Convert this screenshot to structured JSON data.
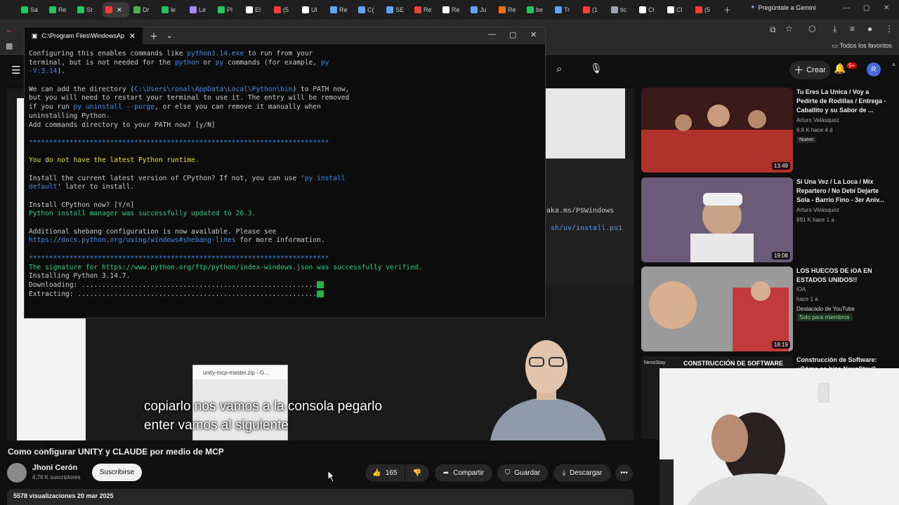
{
  "browser": {
    "tabs": [
      {
        "label": "Sa",
        "color": "#22c55e"
      },
      {
        "label": "Re",
        "color": "#22c55e"
      },
      {
        "label": "St",
        "color": "#22c55e"
      },
      {
        "label": "",
        "color": "#ff3b3b",
        "active": true
      },
      {
        "label": "Dr",
        "color": "#4caf50"
      },
      {
        "label": "le",
        "color": "#22c55e"
      },
      {
        "label": "Le",
        "color": "#a78bfa"
      },
      {
        "label": "Pl",
        "color": "#22c55e"
      },
      {
        "label": "El",
        "color": "#ffffff"
      },
      {
        "label": "(5",
        "color": "#ff3b3b"
      },
      {
        "label": "Ul",
        "color": "#ffffff"
      },
      {
        "label": "Re",
        "color": "#60a5fa"
      },
      {
        "label": "C(",
        "color": "#60a5fa"
      },
      {
        "label": "SE",
        "color": "#60a5fa"
      },
      {
        "label": "Re",
        "color": "#ea4335"
      },
      {
        "label": "Re",
        "color": "#ffffff"
      },
      {
        "label": "Ju",
        "color": "#60a5fa"
      },
      {
        "label": "Re",
        "color": "#f97316"
      },
      {
        "label": "be",
        "color": "#22c55e"
      },
      {
        "label": "Tr",
        "color": "#60a5fa"
      },
      {
        "label": "(1",
        "color": "#ff3b3b"
      },
      {
        "label": "tic",
        "color": "#9ca3af"
      },
      {
        "label": "Cl",
        "color": "#ffffff"
      },
      {
        "label": "Cl",
        "color": "#ffffff"
      },
      {
        "label": "(5",
        "color": "#ff3b3b"
      }
    ],
    "gemini_label": "Pregúntale a Gemini",
    "bookmarks_all": "Todos los favoritos"
  },
  "youtube": {
    "create_label": "Crear",
    "notif_count": "9+",
    "avatar_letter": "R"
  },
  "terminal": {
    "tab_title": "C:\\Program Files\\WindowsAp",
    "lines": [
      [
        [
          "Configuring this enables commands like ",
          ""
        ],
        [
          "python3.14.exe",
          "b"
        ],
        [
          " to run from your",
          ""
        ]
      ],
      [
        [
          "terminal, but is not needed for the ",
          ""
        ],
        [
          "python",
          "b"
        ],
        [
          " or ",
          ""
        ],
        [
          "py",
          "b"
        ],
        [
          " commands (for example, ",
          ""
        ],
        [
          "py",
          "b"
        ]
      ],
      [
        [
          "-V:3.14",
          "b"
        ],
        [
          ").",
          ""
        ]
      ],
      [
        [
          "",
          ""
        ]
      ],
      [
        [
          "We can add the directory (",
          ""
        ],
        [
          "C:\\Users\\ronal\\AppData\\Local\\Python\\bin",
          "b"
        ],
        [
          ") to PATH now,",
          ""
        ]
      ],
      [
        [
          "but you will need to restart your terminal to use it. The entry will be removed",
          ""
        ]
      ],
      [
        [
          "if you run ",
          ""
        ],
        [
          "py uninstall --purge",
          "b"
        ],
        [
          ", or else you can remove it manually when",
          ""
        ]
      ],
      [
        [
          "uninstalling Python.",
          ""
        ]
      ],
      [
        [
          "Add commands directory to your PATH now? [y/N]",
          ""
        ]
      ],
      [
        [
          "",
          ""
        ]
      ],
      [
        [
          "**************************************************************************",
          "b"
        ]
      ],
      [
        [
          "",
          ""
        ]
      ],
      [
        [
          "You do not have the latest Python runtime.",
          "y"
        ]
      ],
      [
        [
          "",
          ""
        ]
      ],
      [
        [
          "Install the current latest version of CPython? If not, you can use '",
          ""
        ],
        [
          "py install",
          "b"
        ]
      ],
      [
        [
          "default",
          "b"
        ],
        [
          "' later to install.",
          ""
        ]
      ],
      [
        [
          "",
          ""
        ]
      ],
      [
        [
          "Install CPython now? [Y/n]",
          ""
        ]
      ],
      [
        [
          "Python install manager was successfully updated to 26.3.",
          "g"
        ]
      ],
      [
        [
          "",
          ""
        ]
      ],
      [
        [
          "Additional shebang configuration is now available. Please see",
          ""
        ]
      ],
      [
        [
          "https://docs.python.org/using/windows#shebang-lines",
          "b"
        ],
        [
          " for more information.",
          ""
        ]
      ],
      [
        [
          "",
          ""
        ]
      ],
      [
        [
          "**************************************************************************",
          "b"
        ]
      ],
      [
        [
          "The signature for https://www.python.org/ftp/python/index-windows.json was successfully verified.",
          "g"
        ]
      ],
      [
        [
          "Installing Python 3.14.7.",
          ""
        ]
      ],
      [
        [
          "Downloading: ..........................................................",
          ""
        ],
        [
          "✓",
          "c"
        ]
      ],
      [
        [
          "Extracting: ...........................................................",
          ""
        ],
        [
          "✓",
          "c"
        ]
      ]
    ]
  },
  "bg_terminal": {
    "line1": "aka.ms/PSWindows",
    "line2": "sh/uv/install.ps1"
  },
  "download_popup": {
    "label": "unity-mcp-master.zip - G..."
  },
  "subtitles": {
    "line1": "copiarlo nos vamos a la consola pegarlo",
    "line2": "enter vamos al siguiente"
  },
  "video": {
    "title": "Como configurar UNITY y CLAUDE por medio de MCP",
    "channel": "Jhoni Cerón",
    "subscribers": "4,76 K suscriptores",
    "subscribe_label": "Suscribirse",
    "likes": "165",
    "share_label": "Compartir",
    "save_label": "Guardar",
    "download_label": "Descargar",
    "views_date": "5578 visualizaciones  20 mar 2025"
  },
  "recommendations": [
    {
      "title": "Tu Eres La Unica / Voy a Pedirte de Rodillas / Entrega - Caballito y su Sabor de ...",
      "channel": "Arturo Velásquez",
      "meta": "6,8 K  hace 4 d",
      "badge": "Nuevo",
      "duration": "13:49",
      "thumb_color": "#7a2a24"
    },
    {
      "title": "Si Una Vez / La Loca / Mix Repartero / No Debí Dejarte Sola - Barrio Fino - 3er Aniv...",
      "channel": "Arturo Velásquez",
      "meta": "891 K  hace 1 a",
      "duration": "19:08",
      "thumb_color": "#5a4a66"
    },
    {
      "title": "LOS HUECOS DE iOA EN ESTADOS UNIDOS!!",
      "channel": "iOA",
      "meta": "hace 1 a",
      "extra": "Destacado de YouTube",
      "member": "Solo para miembros",
      "duration": "18:19",
      "thumb_color": "#8c8c8c"
    },
    {
      "title": "Construcción de Software: ¿Cómo se hizo NexoStay?",
      "thumb_label": "CONSTRUCCIÓN DE SOFTWARE",
      "brand": "NexoStay"
    }
  ],
  "colors": {
    "yt_bg": "#0f0f0f",
    "pill": "#272727",
    "terminal_bg": "#0c0c0c",
    "link_blue": "#3b8eea",
    "warn_yellow": "#e5e510",
    "ok_green": "#23d18b",
    "notif_red": "#cc0000"
  },
  "icons": {
    "menu": "hamburger-icon",
    "search": "search-icon",
    "mic": "mic-icon",
    "bell": "bell-icon",
    "like": "thumb-up-icon",
    "dislike": "thumb-down-icon",
    "share": "share-icon",
    "save": "bookmark-icon",
    "download": "download-icon",
    "more": "more-icon"
  }
}
